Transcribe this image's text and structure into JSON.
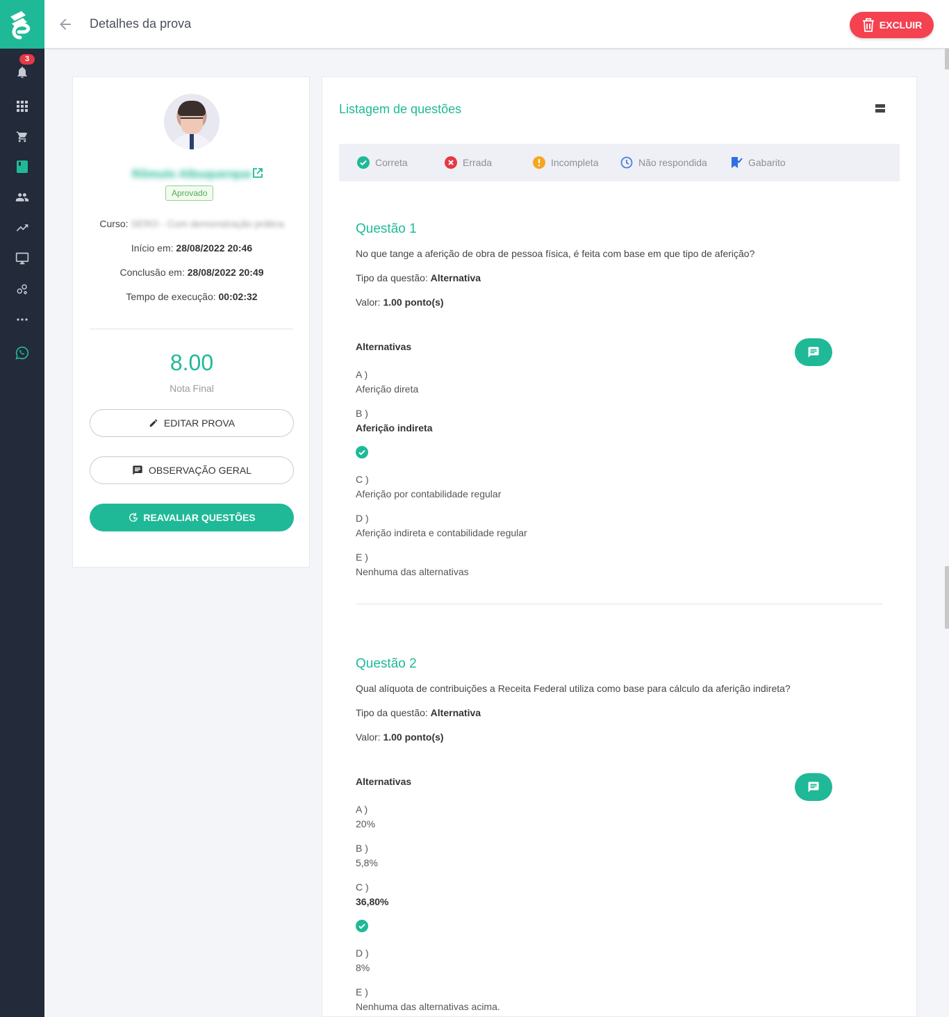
{
  "header": {
    "title": "Detalhes da prova",
    "delete_label": "EXCLUIR"
  },
  "sidebar": {
    "notification_count": "3",
    "items": [
      "bell-icon",
      "apps-icon",
      "cart-icon",
      "book-icon",
      "users-icon",
      "trending-icon",
      "monitor-icon",
      "bubbles-icon",
      "more-icon",
      "whatsapp-icon"
    ]
  },
  "student": {
    "name": "Rômulo Albuquerque",
    "status": "Aprovado",
    "course_label": "Curso:",
    "course_value": "SERO - Com demonstração prática",
    "start_label": "Início em:",
    "start_value": "28/08/2022 20:46",
    "end_label": "Conclusão em:",
    "end_value": "28/08/2022 20:49",
    "duration_label": "Tempo de execução:",
    "duration_value": "00:02:32",
    "grade": "8.00",
    "grade_label": "Nota Final"
  },
  "actions": {
    "edit": "EDITAR PROVA",
    "observation": "OBSERVAÇÃO GERAL",
    "reevaluate": "REAVALIAR QUESTÕES"
  },
  "list": {
    "title": "Listagem de questões",
    "legend": {
      "correct": "Correta",
      "wrong": "Errada",
      "incomplete": "Incompleta",
      "unanswered": "Não respondida",
      "answer_key": "Gabarito"
    }
  },
  "colors": {
    "accent": "#1fb997",
    "danger": "#f44250",
    "sidebar": "#232a39"
  },
  "questions": [
    {
      "title": "Questão 1",
      "text": "No que tange a aferição de obra de pessoa física, é feita com base em que tipo de aferição?",
      "type_label": "Tipo da questão:",
      "type_value": "Alternativa",
      "value_label": "Valor:",
      "value_value": "1.00 ponto(s)",
      "alternatives_label": "Alternativas",
      "alternatives": [
        {
          "letter": "A )",
          "text": "Aferição direta"
        },
        {
          "letter": "B )",
          "text": "Aferição indireta"
        },
        {
          "letter": "C )",
          "text": "Aferição por contabilidade regular"
        },
        {
          "letter": "D )",
          "text": "Aferição indireta e contabilidade regular"
        },
        {
          "letter": "E )",
          "text": "Nenhuma das alternativas"
        }
      ]
    },
    {
      "title": "Questão 2",
      "text": "Qual alíquota de contribuições a Receita Federal utiliza como base para cálculo da aferição indireta?",
      "type_label": "Tipo da questão:",
      "type_value": "Alternativa",
      "value_label": "Valor:",
      "value_value": "1.00 ponto(s)",
      "alternatives_label": "Alternativas",
      "alternatives": [
        {
          "letter": "A )",
          "text": "20%"
        },
        {
          "letter": "B )",
          "text": "5,8%"
        },
        {
          "letter": "C )",
          "text": "36,80%"
        },
        {
          "letter": "D )",
          "text": "8%"
        },
        {
          "letter": "E )",
          "text": "Nenhuma das alternativas acima."
        }
      ]
    }
  ]
}
